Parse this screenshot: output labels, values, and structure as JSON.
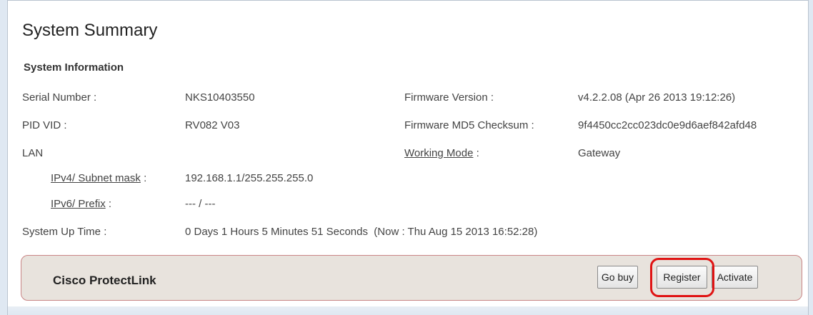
{
  "page": {
    "title": "System Summary"
  },
  "system_information": {
    "heading": "System Information",
    "serial_number": {
      "label": "Serial Number :",
      "value": "NKS10403550"
    },
    "pid_vid": {
      "label": "PID VID :",
      "value": "RV082 V03"
    },
    "lan": {
      "label": "LAN"
    },
    "ipv4": {
      "label": "IPv4/ Subnet mask",
      "separator": ":",
      "value": "192.168.1.1/255.255.255.0"
    },
    "ipv6": {
      "label": "IPv6/ Prefix",
      "separator": ":",
      "value": "--- / ---"
    },
    "uptime": {
      "label": "System Up Time :",
      "value": "0 Days 1 Hours 5 Minutes 51 Seconds  (Now : Thu Aug 15 2013 16:52:28)"
    },
    "firmware_version": {
      "label": "Firmware Version :",
      "value": "v4.2.2.08 (Apr 26 2013 19:12:26)"
    },
    "firmware_md5": {
      "label": "Firmware MD5 Checksum :",
      "value": "9f4450cc2cc023dc0e9d6aef842afd48"
    },
    "working_mode": {
      "label": "Working Mode",
      "separator": ":",
      "value": "Gateway"
    }
  },
  "protectlink": {
    "title": "Cisco ProtectLink",
    "buttons": {
      "go_buy": "Go buy",
      "register": "Register",
      "activate": "Activate"
    }
  },
  "colors": {
    "highlight": "#e01414",
    "panel_bg": "#e8e3dd",
    "panel_border": "#c98585"
  }
}
